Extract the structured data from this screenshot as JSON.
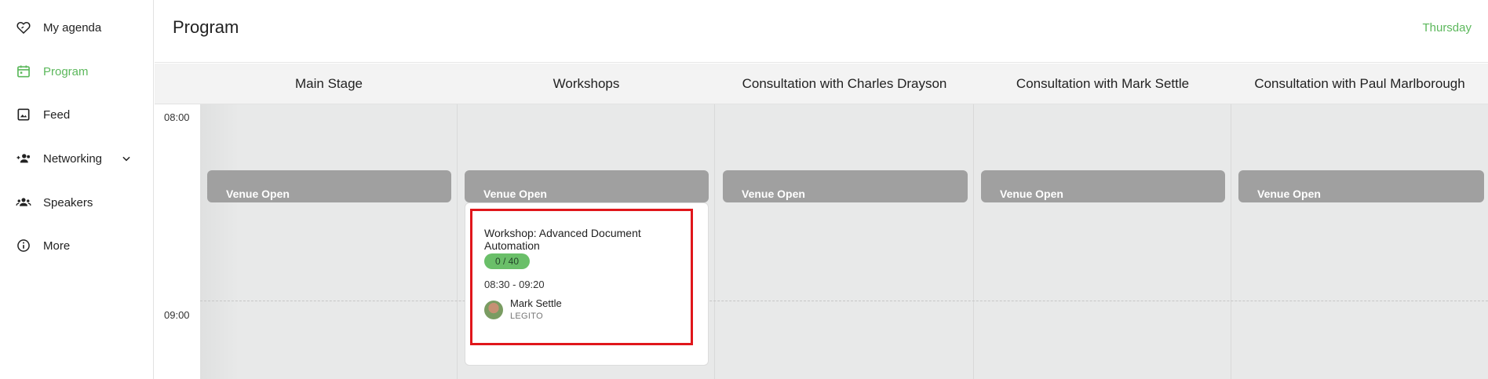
{
  "sidebar": {
    "items": [
      {
        "label": "My agenda",
        "icon": "heart-outline-icon",
        "active": false
      },
      {
        "label": "Program",
        "icon": "calendar-icon",
        "active": true
      },
      {
        "label": "Feed",
        "icon": "image-icon",
        "active": false
      },
      {
        "label": "Networking",
        "icon": "people-add-icon",
        "active": false,
        "expandable": true
      },
      {
        "label": "Speakers",
        "icon": "group-icon",
        "active": false
      },
      {
        "label": "More",
        "icon": "info-icon",
        "active": false
      }
    ]
  },
  "header": {
    "title": "Program",
    "day": "Thursday"
  },
  "schedule": {
    "tracks": [
      "Main Stage",
      "Workshops",
      "Consultation with Charles Drayson",
      "Consultation with Mark Settle",
      "Consultation with Paul Marlborough"
    ],
    "times": [
      "08:00",
      "09:00"
    ],
    "venue_label": "Venue Open",
    "session": {
      "title": "Workshop: Advanced Document Automation",
      "capacity": "0 / 40",
      "time": "08:30 - 09:20",
      "speaker_name": "Mark Settle",
      "speaker_org": "LEGITO"
    }
  },
  "colors": {
    "accent": "#5cb85c",
    "venue_block": "#a0a0a0",
    "highlight": "#e0161b",
    "grid": "#e8e9e9"
  }
}
